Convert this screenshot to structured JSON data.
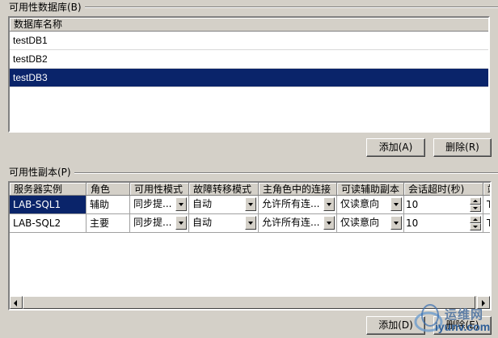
{
  "databases_group": {
    "title": "可用性数据库(B)",
    "column_header": "数据库名称",
    "rows": [
      "testDB1",
      "testDB2",
      "testDB3"
    ],
    "selected_index": 2,
    "add_button": "添加(A)",
    "remove_button": "删除(R)"
  },
  "replicas_group": {
    "title": "可用性副本(P)",
    "columns": [
      "服务器实例",
      "角色",
      "可用性模式",
      "故障转移模式",
      "主角色中的连接",
      "可读辅助副本",
      "会话超时(秒)",
      "端"
    ],
    "rows": [
      {
        "server": "LAB-SQL1",
        "role": "辅助",
        "availability_mode": "同步提...",
        "failover_mode": "自动",
        "primary_connections": "允许所有连...",
        "readable_secondary": "仅读意向",
        "session_timeout": "10",
        "overflow": "T"
      },
      {
        "server": "LAB-SQL2",
        "role": "主要",
        "availability_mode": "同步提...",
        "failover_mode": "自动",
        "primary_connections": "允许所有连...",
        "readable_secondary": "仅读意向",
        "session_timeout": "10",
        "overflow": "T"
      }
    ],
    "add_button": "添加(D)",
    "remove_button": "删除(E)"
  },
  "watermark": {
    "text": "运维网",
    "url": "iyunv.com"
  },
  "colors": {
    "selection": "#0a246a",
    "face": "#d4d0c8"
  }
}
